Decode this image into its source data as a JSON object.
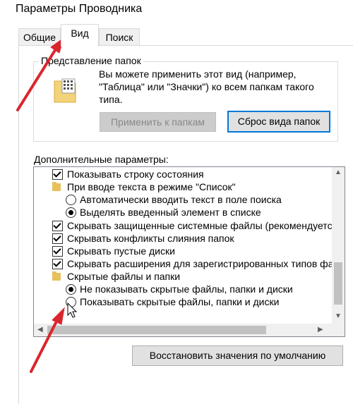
{
  "window": {
    "title": "Параметры Проводника"
  },
  "tabs": [
    {
      "label": "Общие"
    },
    {
      "label": "Вид"
    },
    {
      "label": "Поиск"
    }
  ],
  "folder_view": {
    "legend": "Представление папок",
    "description": "Вы можете применить этот вид (например, \"Таблица\" или \"Значки\") ко всем папкам такого типа.",
    "apply_button": "Применить к папкам",
    "reset_button": "Сброс вида папок"
  },
  "advanced": {
    "label": "Дополнительные параметры:",
    "items": [
      {
        "type": "checkbox",
        "label": "Показывать строку состояния"
      },
      {
        "type": "folder",
        "label": "При вводе текста в режиме \"Список\""
      },
      {
        "type": "radio",
        "checked": false,
        "label": "Автоматически вводить текст в поле поиска"
      },
      {
        "type": "radio",
        "checked": true,
        "label": "Выделять введенный элемент в списке"
      },
      {
        "type": "checkbox",
        "label": "Скрывать защищенные системные файлы (рекомендуетс"
      },
      {
        "type": "checkbox",
        "label": "Скрывать конфликты слияния папок"
      },
      {
        "type": "checkbox",
        "label": "Скрывать пустые диски"
      },
      {
        "type": "checkbox",
        "label": "Скрывать расширения для зарегистрированных типов фа"
      },
      {
        "type": "folder",
        "label": "Скрытые файлы и папки"
      },
      {
        "type": "radio",
        "checked": true,
        "label": "Не показывать скрытые файлы, папки и диски"
      },
      {
        "type": "radio",
        "checked": false,
        "label": "Показывать скрытые файлы, папки и диски"
      }
    ]
  },
  "restore_button": "Восстановить значения по умолчанию",
  "colors": {
    "annotation_arrow": "#d9262c",
    "focus": "#0078d7"
  }
}
